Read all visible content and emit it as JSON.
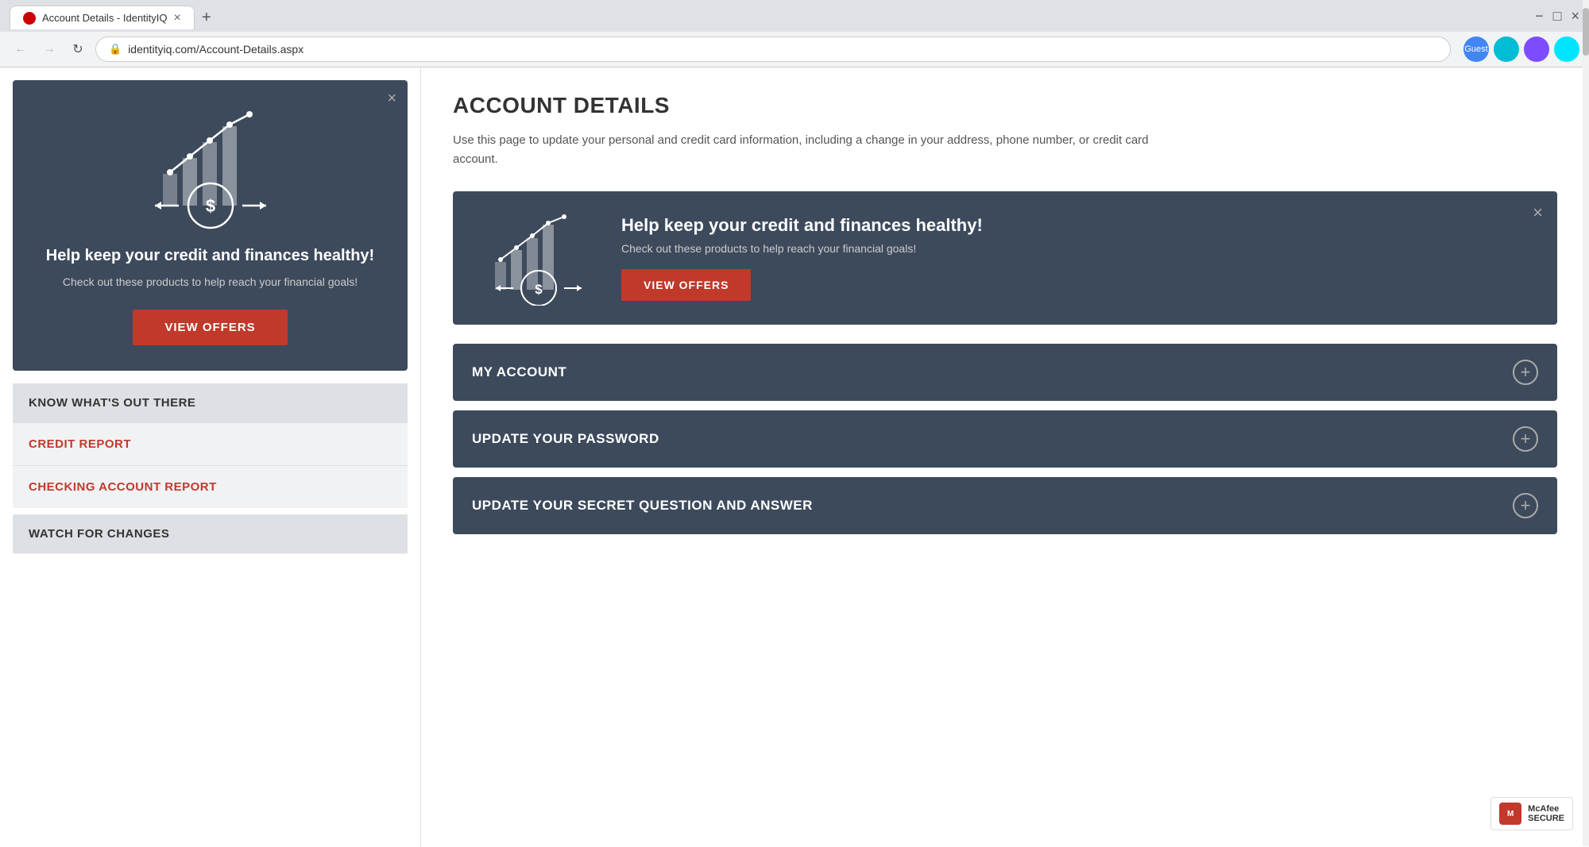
{
  "browser": {
    "tab_title": "Account Details - IdentityIQ",
    "url": "identityiq.com/Account-Details.aspx",
    "close_btn": "×",
    "new_tab_btn": "+",
    "minimize": "−",
    "maximize": "□",
    "window_close": "×",
    "back": "←",
    "forward": "→",
    "refresh": "↻",
    "profile_label": "Guest"
  },
  "promo_left": {
    "title": "Help keep your credit and finances healthy!",
    "description": "Check out these products to help reach your financial goals!",
    "btn_label": "VIEW OFFERS"
  },
  "sidebar": {
    "know_section_title": "KNOW WHAT'S OUT THERE",
    "links": [
      {
        "label": "CREDIT REPORT"
      },
      {
        "label": "CHECKING ACCOUNT REPORT"
      }
    ],
    "watch_title": "WATCH FOR CHANGES"
  },
  "main": {
    "page_title": "ACCOUNT DETAILS",
    "page_desc": "Use this page to update your personal and credit card information, including a change in your address, phone number, or credit card account.",
    "promo_banner": {
      "title": "Help keep your credit and finances healthy!",
      "description": "Check out these products to help reach your financial goals!",
      "btn_label": "VIEW OFFERS"
    },
    "accordion": [
      {
        "label": "MY ACCOUNT"
      },
      {
        "label": "UPDATE YOUR PASSWORD"
      },
      {
        "label": "UPDATE YOUR SECRET QUESTION AND ANSWER"
      }
    ]
  },
  "mcafee": {
    "line1": "McAfee",
    "line2": "SECURE"
  }
}
